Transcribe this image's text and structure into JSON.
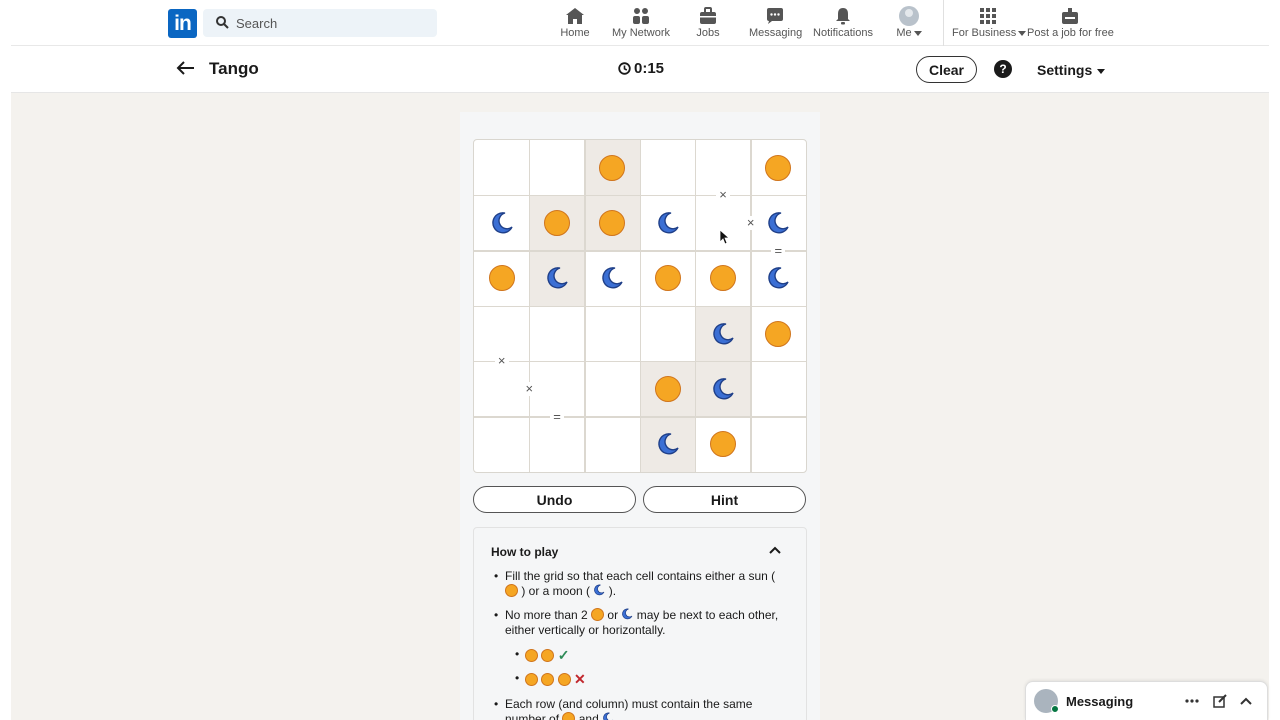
{
  "topnav": {
    "logo": "in",
    "search_placeholder": "Search",
    "items": [
      {
        "label": "Home",
        "icon": "home-icon"
      },
      {
        "label": "My Network",
        "icon": "network-icon"
      },
      {
        "label": "Jobs",
        "icon": "briefcase-icon"
      },
      {
        "label": "Messaging",
        "icon": "messaging-icon"
      },
      {
        "label": "Notifications",
        "icon": "bell-icon"
      },
      {
        "label": "Me",
        "icon": "avatar"
      },
      {
        "label": "For Business",
        "icon": "grid-icon"
      },
      {
        "label": "Post a job for free",
        "icon": "post-job-icon"
      }
    ]
  },
  "game": {
    "title": "Tango",
    "timer": "0:15",
    "clear_label": "Clear",
    "help_label": "?",
    "settings_label": "Settings",
    "undo_label": "Undo",
    "hint_label": "Hint",
    "board": {
      "rows": 6,
      "cols": 6,
      "cells": [
        [
          "",
          "",
          "sun",
          "",
          "",
          "sun"
        ],
        [
          "moon",
          "sun",
          "sun",
          "moon",
          "",
          "moon"
        ],
        [
          "sun",
          "moon",
          "moon",
          "sun",
          "sun",
          "moon"
        ],
        [
          "",
          "",
          "",
          "",
          "moon",
          "sun"
        ],
        [
          "",
          "",
          "",
          "sun",
          "moon",
          ""
        ],
        [
          "",
          "",
          "",
          "moon",
          "sun",
          ""
        ]
      ],
      "locked": [
        [
          0,
          2
        ],
        [
          1,
          1
        ],
        [
          1,
          2
        ],
        [
          2,
          1
        ],
        [
          3,
          4
        ],
        [
          4,
          3
        ],
        [
          4,
          4
        ],
        [
          5,
          3
        ]
      ],
      "constraints": [
        {
          "symbol": "×",
          "between": [
            [
              0,
              4
            ],
            [
              1,
              4
            ]
          ]
        },
        {
          "symbol": "×",
          "between": [
            [
              1,
              4
            ],
            [
              1,
              5
            ]
          ]
        },
        {
          "symbol": "=",
          "between": [
            [
              1,
              5
            ],
            [
              2,
              5
            ]
          ]
        },
        {
          "symbol": "×",
          "between": [
            [
              3,
              0
            ],
            [
              4,
              0
            ]
          ]
        },
        {
          "symbol": "×",
          "between": [
            [
              4,
              0
            ],
            [
              4,
              1
            ]
          ]
        },
        {
          "symbol": "=",
          "between": [
            [
              4,
              1
            ],
            [
              5,
              1
            ]
          ]
        }
      ]
    }
  },
  "howto": {
    "title": "How to play",
    "rule1_a": "Fill the grid so that each cell contains either a sun (",
    "rule1_b": ") or a moon (",
    "rule1_c": ").",
    "rule2_a": "No more than 2",
    "rule2_b": "or",
    "rule2_c": "may be next to each other, either vertically or horizontally.",
    "rule3_a": "Each row (and column) must contain the same number of",
    "rule3_b": "and"
  },
  "messaging": {
    "label": "Messaging"
  },
  "colors": {
    "sun": "#f5a623",
    "moon": "#3b6fd4",
    "linkedin_blue": "#0a66c2",
    "locked_cell": "#eeeae5"
  }
}
